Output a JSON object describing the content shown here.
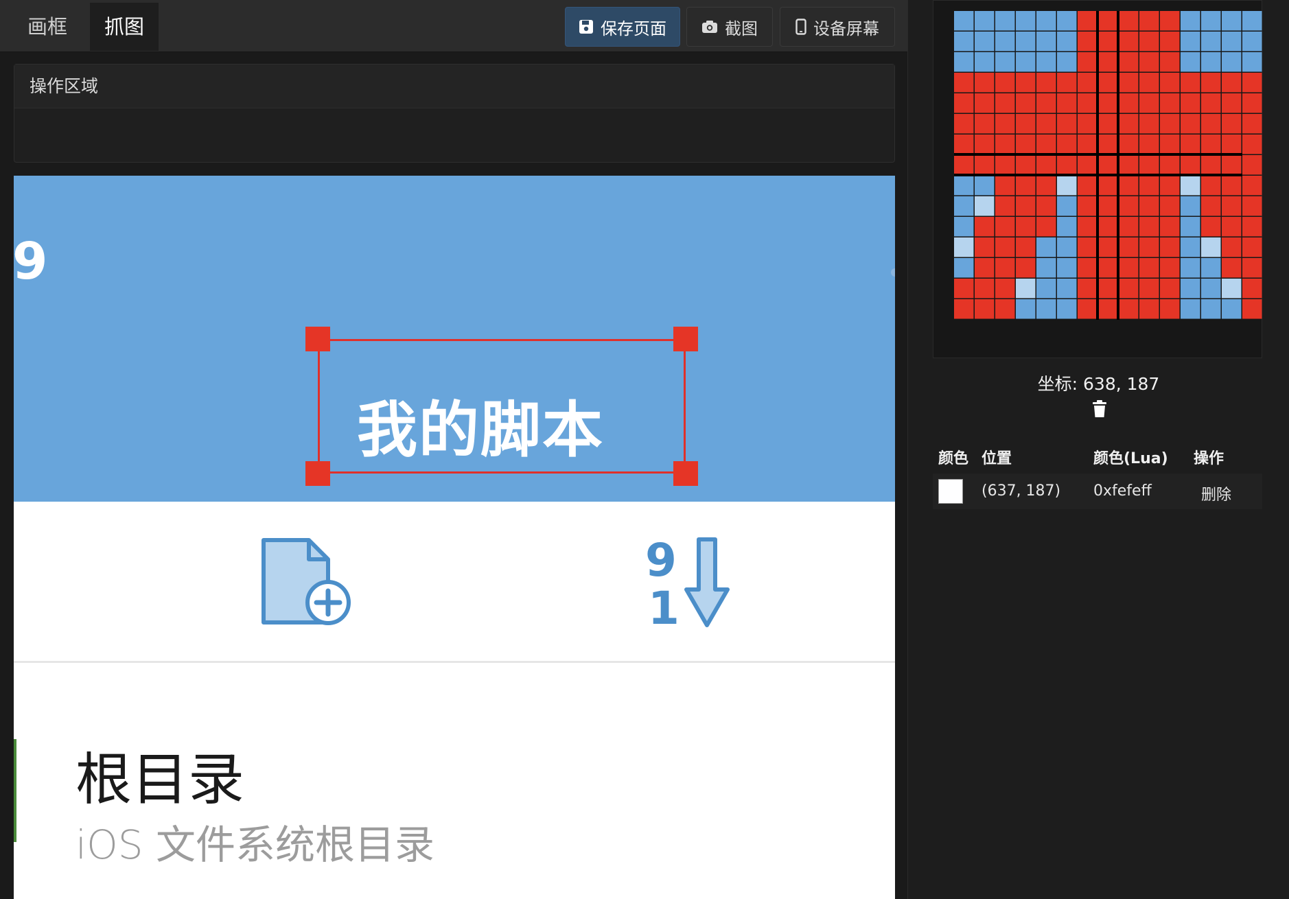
{
  "tabs": [
    {
      "label": "画框",
      "active": false
    },
    {
      "label": "抓图",
      "active": true
    }
  ],
  "toolbar": {
    "save_label": "保存页面",
    "screenshot_label": "截图",
    "device_label": "设备屏幕",
    "save_icon": "floppy-disk-icon",
    "screenshot_icon": "camera-icon",
    "device_icon": "phone-icon"
  },
  "operation_area": {
    "title": "操作区域"
  },
  "device_screen": {
    "corner_number": "9",
    "header_title": "我的脚本",
    "header_color": "#68a5db",
    "selection_color": "#e53526",
    "toolbar_icons": [
      "new-file-icon",
      "sort-descending-icon"
    ],
    "sort_icon_top_digit": "9",
    "sort_icon_bottom_digit": "1",
    "list_item": {
      "title": "根目录",
      "subtitle": "iOS 文件系统根目录"
    }
  },
  "magnifier": {
    "coordinate_label": "坐标: 638, 187",
    "crosshair_color": "#000000",
    "palette": {
      "R": "#e53526",
      "B": "#68a5db",
      "L": "#b6d4ee"
    },
    "pixel_rows": [
      "BBBBBBRRRRRBBBB",
      "BBBBBBRRRRRBBBB",
      "BBBBBBRRRRRBBBB",
      "RRRRRRRRRRRRRRR",
      "RRRRRRRRRRRRRRR",
      "RRRRRRRRRRRRRRR",
      "RRRRRRRRRRRRRRR",
      "RRRRRRRRRRRRRRR",
      "BBRRRLRRRRRLRRR",
      "BLRRRBRRRRRBRRR",
      "BRRRRBRRRRRBRRR",
      "LRRRBBRRRRRBLRR",
      "BRRRBBRRRRRBBRR",
      "RRRLBBRRRRRBBLR",
      "RRRBBBRRRRRBBBR"
    ],
    "delete_icon": "trash-icon"
  },
  "color_table": {
    "headers": [
      "颜色",
      "位置",
      "颜色(Lua)",
      "操作"
    ],
    "rows": [
      {
        "swatch": "#fefeff",
        "position": "(637, 187)",
        "lua_color": "0xfefeff",
        "action": "删除"
      }
    ]
  }
}
